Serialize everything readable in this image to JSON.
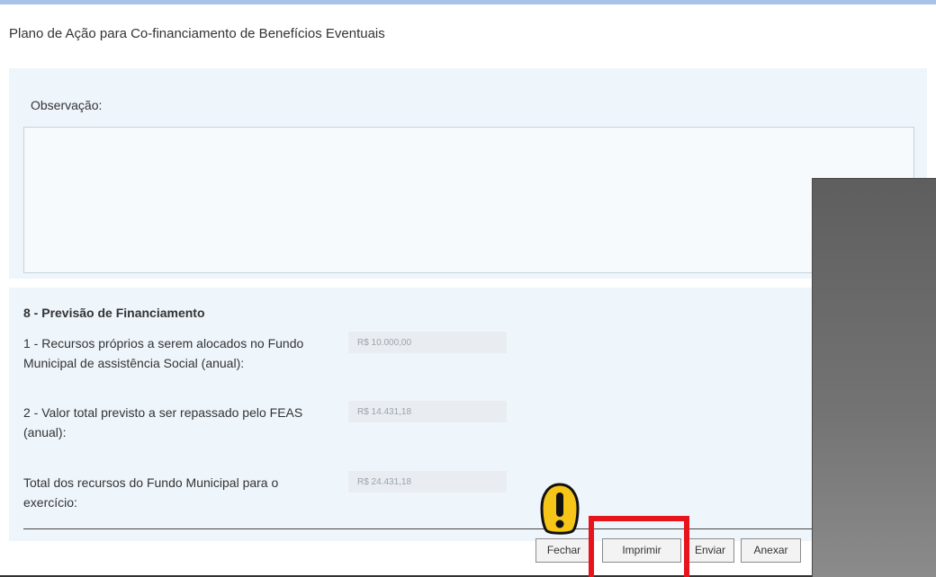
{
  "page": {
    "title": "Plano de Ação para Co-financiamento de Benefícios Eventuais"
  },
  "observacao": {
    "label": "Observação:",
    "value": ""
  },
  "financiamento": {
    "section_title": "8 - Previsão de Financiamento",
    "fields": [
      {
        "label": "1 - Recursos próprios a serem alocados no Fundo Municipal de assistência Social (anual):",
        "value": "R$ 10.000,00"
      },
      {
        "label": "2 - Valor total previsto a ser repassado pelo FEAS (anual):",
        "value": "R$ 14.431,18"
      },
      {
        "label": "Total dos recursos do Fundo Municipal para o exercício:",
        "value": "R$ 24.431,18"
      }
    ]
  },
  "buttons": {
    "fechar": "Fechar",
    "imprimir": "Imprimir",
    "enviar": "Enviar",
    "anexar": "Anexar"
  },
  "icons": {
    "warning": "warning-icon"
  },
  "colors": {
    "panel_bg": "#eef5fb",
    "highlight": "#e8141c",
    "warning": "#f5c518",
    "topbar": "#a7c4e8"
  }
}
